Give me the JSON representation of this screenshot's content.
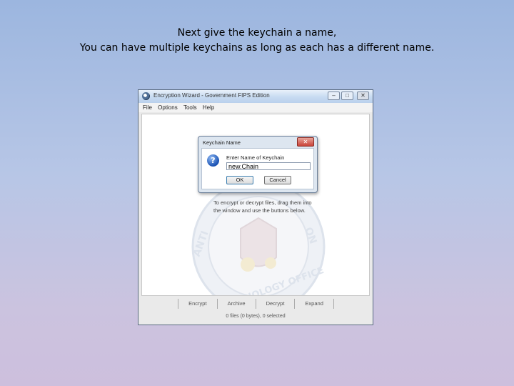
{
  "caption": {
    "line1": "Next give the keychain a name,",
    "line2": "You can have multiple keychains as long as each has a different name."
  },
  "window": {
    "title": "Encryption Wizard - Government FIPS Edition",
    "controls": {
      "minimize": "–",
      "maximize": "□",
      "close": "✕"
    },
    "menu": [
      "File",
      "Options",
      "Tools",
      "Help"
    ],
    "hint": "To encrypt or decrypt files, drag them into the window and use the buttons below.",
    "toolbar": [
      "Encrypt",
      "Archive",
      "Decrypt",
      "Expand"
    ],
    "status": "0 files (0 bytes), 0 selected",
    "seal_text": {
      "left": "ANTI",
      "right": "ON",
      "bottom": "TECHNOLOGY OFFICE"
    }
  },
  "dialog": {
    "title": "Keychain Name",
    "close": "✕",
    "prompt": "Enter Name of Keychain",
    "input_value": "new.Chain",
    "ok_label": "OK",
    "cancel_label": "Cancel",
    "icon": "question-icon"
  }
}
